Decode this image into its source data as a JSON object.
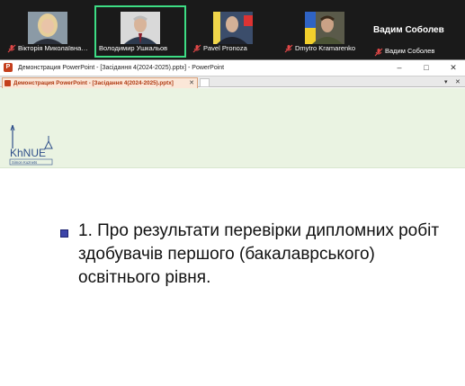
{
  "meeting": {
    "participants": [
      {
        "name": "Вікторія Миколаївна ...",
        "muted": true
      },
      {
        "name": "Володимир Ушкальов",
        "muted": false,
        "active": true
      },
      {
        "name": "Pavel Pronoza",
        "muted": true
      },
      {
        "name": "Dmytro Kramarenko",
        "muted": true
      },
      {
        "name": "Вадим Соболев",
        "muted": true
      }
    ],
    "featured_name": "Вадим Соболев"
  },
  "window": {
    "title": "Демонстрация PowerPoint - [Засідання 4(2024-2025).pptx] - PowerPoint",
    "controls": {
      "minimize": "–",
      "maximize": "□",
      "close": "✕"
    },
    "doc_tab": {
      "label": "Демонстрация PowerPoint - [Засідання 4(2024-2025).pptx]",
      "close": "✕"
    },
    "tab_nav": {
      "dropdown": "▾",
      "close": "✕"
    }
  },
  "slide": {
    "logo": {
      "text": "KhNUE",
      "subtitle": "Simon Kuznets"
    },
    "bullet_text": "1. Про результати перевірки дипломних робіт здобувачів першого (бакалаврського) освітнього рівня.",
    "colors": {
      "header_band": "#eaf3e2",
      "bullet": "#3d45a8",
      "logo": "#2f4f8a"
    }
  },
  "icons": [
    "mic-muted-icon",
    "powerpoint-icon",
    "minimize-icon",
    "maximize-icon",
    "close-icon",
    "dropdown-icon"
  ]
}
